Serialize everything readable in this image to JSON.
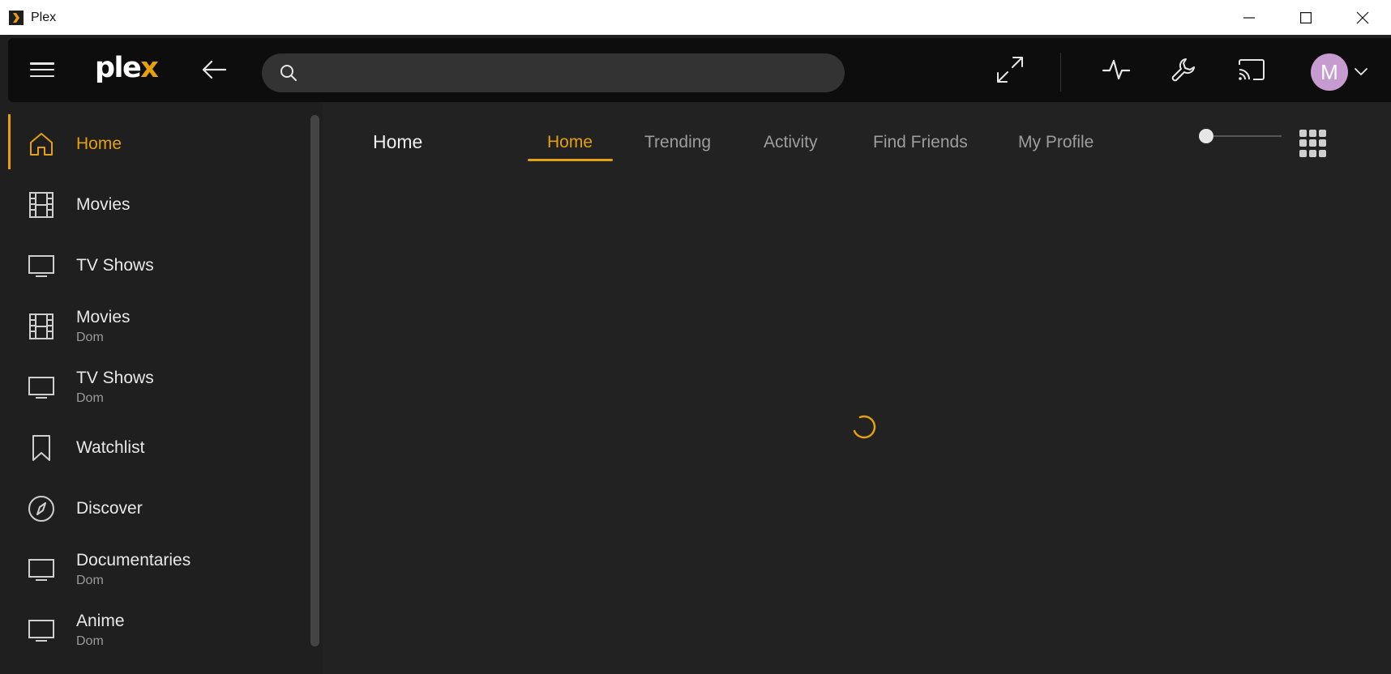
{
  "window": {
    "title": "Plex",
    "icons": [
      "plex-app-icon",
      "minimize-icon",
      "maximize-icon",
      "close-icon"
    ]
  },
  "topbar": {
    "logo_main": "ple",
    "logo_accent": "x",
    "search": {
      "placeholder": "",
      "value": ""
    },
    "avatar_initial": "M",
    "icons": [
      "menu-icon",
      "back-arrow-icon",
      "search-icon",
      "fullscreen-icon",
      "activity-icon",
      "settings-wrench-icon",
      "cast-icon",
      "chevron-down-icon"
    ]
  },
  "sidebar": {
    "items": [
      {
        "label": "Home",
        "sub": "",
        "icon": "home-icon",
        "active": true
      },
      {
        "label": "Movies",
        "sub": "",
        "icon": "film-icon"
      },
      {
        "label": "TV Shows",
        "sub": "",
        "icon": "tv-icon"
      },
      {
        "label": "Movies",
        "sub": "Dom",
        "icon": "film-icon"
      },
      {
        "label": "TV Shows",
        "sub": "Dom",
        "icon": "tv-icon"
      },
      {
        "label": "Watchlist",
        "sub": "",
        "icon": "bookmark-icon"
      },
      {
        "label": "Discover",
        "sub": "",
        "icon": "compass-icon"
      },
      {
        "label": "Documentaries",
        "sub": "Dom",
        "icon": "tv-icon"
      },
      {
        "label": "Anime",
        "sub": "Dom",
        "icon": "tv-icon"
      }
    ]
  },
  "main": {
    "title": "Home",
    "tabs": [
      {
        "label": "Home",
        "active": true
      },
      {
        "label": "Trending"
      },
      {
        "label": "Activity"
      },
      {
        "label": "Find Friends"
      },
      {
        "label": "My Profile"
      }
    ],
    "size_slider_value": 0,
    "icons": [
      "grid-view-icon",
      "loading-spinner-icon"
    ]
  },
  "colors": {
    "accent": "#e5a00d",
    "background": "#1f1f1f",
    "topbar": "#0d0d0d",
    "avatar": "#c59bd0"
  }
}
